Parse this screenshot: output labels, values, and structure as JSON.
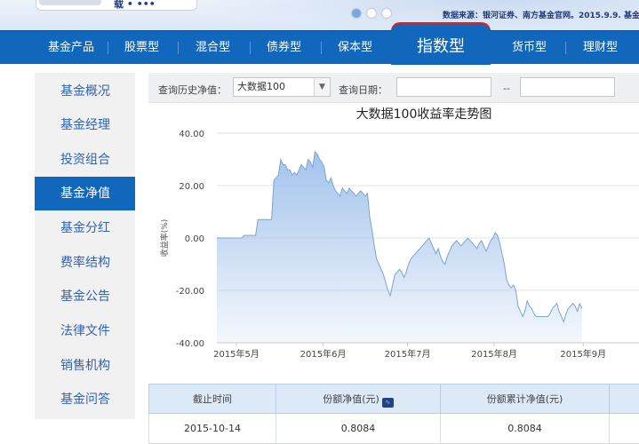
{
  "banner": {
    "logo_glyph": "载 • •••",
    "note": "数据来源：银河证券、南方基金官网。2015.9.9.  基金"
  },
  "nav": {
    "items": [
      "基金产品",
      "股票型",
      "混合型",
      "债券型",
      "保本型",
      "指数型",
      "货币型",
      "理财型"
    ],
    "active": "指数型",
    "accent_color": "#e02020",
    "bar_color": "#1167bb"
  },
  "sidebar": {
    "items": [
      "基金概况",
      "基金经理",
      "投资组合",
      "基金净值",
      "基金分红",
      "费率结构",
      "基金公告",
      "法律文件",
      "销售机构",
      "基金问答"
    ],
    "active": "基金净值"
  },
  "query": {
    "history_label": "查询历史净值：",
    "fund_selected": "大数据100",
    "date_label": "查询日期：",
    "date_sep": "--",
    "date_from": "",
    "date_to": ""
  },
  "chart_data": {
    "type": "area",
    "title": "大数据100收益率走势图",
    "ylabel": "收益率(%)",
    "xlabel": "",
    "ylim": [
      -40,
      40
    ],
    "yticks": [
      "40.00",
      "20.00",
      "0.00",
      "-20.00",
      "-40.00"
    ],
    "xticks": [
      "2015年5月",
      "2015年6月",
      "2015年7月",
      "2015年8月",
      "2015年9月"
    ],
    "grid": true,
    "fill_color": "#9ec0ea",
    "line_color": "#7aa3d8",
    "series": [
      {
        "x": [
          0,
          1,
          2,
          3,
          4,
          5,
          6,
          7,
          8,
          9,
          10,
          11,
          12,
          13,
          14,
          15,
          16,
          17,
          18,
          19,
          20,
          21,
          22,
          23,
          24,
          25,
          26,
          27,
          28,
          29,
          30,
          31,
          32,
          33,
          34,
          35,
          36,
          37,
          38,
          39,
          40,
          41,
          42,
          43,
          44,
          45,
          46,
          47,
          48,
          49,
          50,
          51,
          52,
          53,
          54,
          55,
          56,
          57,
          58,
          59,
          60,
          61,
          62,
          63,
          64,
          65,
          66,
          67,
          68,
          69,
          70,
          71,
          72,
          73,
          74,
          75,
          76,
          77,
          78,
          79,
          80,
          81,
          82,
          83,
          84,
          85,
          86,
          87,
          88,
          89,
          90,
          91,
          92,
          93,
          94,
          95,
          96,
          97,
          98,
          99,
          100,
          101,
          102,
          103,
          104,
          105,
          106,
          107,
          108,
          109,
          110,
          111,
          112,
          113,
          114,
          115,
          116,
          117,
          118,
          119,
          120,
          121,
          122,
          123,
          124,
          125,
          126,
          127,
          128,
          129,
          130,
          131,
          132,
          133,
          134,
          135,
          136,
          137,
          138,
          139,
          140,
          141,
          142,
          143,
          144,
          145,
          146,
          147,
          148,
          149,
          150,
          151,
          152,
          153,
          154,
          155,
          156,
          157,
          158,
          159,
          160
        ],
        "values": [
          0,
          0,
          0,
          0,
          0,
          0,
          0,
          0,
          0,
          0,
          0,
          0,
          1,
          1,
          1,
          1,
          1,
          1,
          7,
          7,
          7,
          7,
          7,
          7,
          7,
          22,
          23,
          24,
          30,
          28,
          28,
          26,
          26,
          24,
          25,
          24,
          26,
          28,
          27,
          26,
          30,
          29,
          27,
          33,
          32,
          30,
          29,
          27,
          22,
          21,
          23,
          20,
          18,
          17,
          16,
          19,
          18,
          17,
          19,
          18,
          17,
          16,
          17,
          18,
          17,
          16,
          17,
          8,
          3,
          -3,
          -8,
          -10,
          -12,
          -14,
          -17,
          -20,
          -22,
          -18,
          -14,
          -13,
          -12,
          -13,
          -15,
          -13,
          -10,
          -8,
          -7,
          -6,
          -5,
          -4,
          -3,
          -2,
          -1,
          0,
          -2,
          -4,
          -6,
          -4,
          -7,
          -9,
          -10,
          -7,
          -5,
          -3,
          -2,
          -1,
          -2,
          -3,
          -2,
          -1,
          0,
          -1,
          -2,
          -3,
          -4,
          -2,
          -1,
          -3,
          -5,
          -3,
          -1,
          0,
          2,
          1,
          -2,
          -6,
          -10,
          -16,
          -18,
          -19,
          -18,
          -20,
          -26,
          -28,
          -30,
          -28,
          -24,
          -26,
          -27,
          -29,
          -30,
          -30,
          -30,
          -30,
          -30,
          -30,
          -29,
          -27,
          -26,
          -25,
          -28,
          -30,
          -32,
          -29,
          -27,
          -26,
          -25,
          -26,
          -28,
          -25,
          -27
        ]
      }
    ]
  },
  "table": {
    "headers": [
      "截止时间",
      "份额净值(元)",
      "份额累计净值(元)",
      ""
    ],
    "rows": [
      [
        "2015-10-14",
        "0.8084",
        "0.8084",
        ""
      ]
    ],
    "header_color": "#dce9f7"
  }
}
